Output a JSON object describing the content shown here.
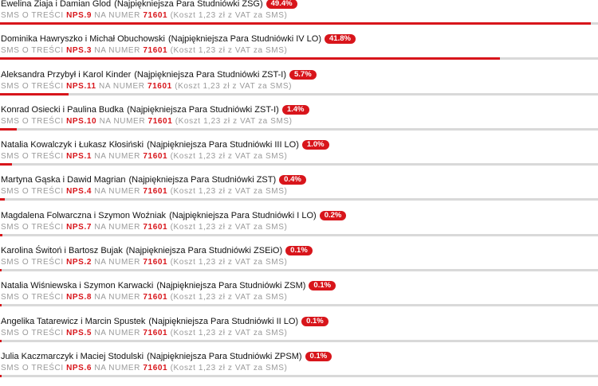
{
  "sms": {
    "prefix": "SMS O TREŚCI",
    "na_numer": "NA NUMER",
    "number": "71601",
    "cost": "(Koszt 1,23 zł z VAT za SMS)"
  },
  "contestants": [
    {
      "names": "Ewelina Ziaja i Damian Glod",
      "school": "(Najpiękniejsza Para Studniówki ZSG)",
      "percent_label": "49.4%",
      "percent": 49.4,
      "code": "NPS.9"
    },
    {
      "names": "Dominika Hawryszko i Michał Obuchowski",
      "school": "(Najpiękniejsza Para Studniówki IV LO)",
      "percent_label": "41.8%",
      "percent": 41.8,
      "code": "NPS.3"
    },
    {
      "names": "Aleksandra Przybył i Karol Kinder",
      "school": "(Najpiękniejsza Para Studniówki ZST-I)",
      "percent_label": "5.7%",
      "percent": 5.7,
      "code": "NPS.11"
    },
    {
      "names": "Konrad Osiecki i Paulina Budka",
      "school": "(Najpiękniejsza Para Studniówki ZST-I)",
      "percent_label": "1.4%",
      "percent": 1.4,
      "code": "NPS.10"
    },
    {
      "names": "Natalia Kowalczyk i Łukasz Kłosiński",
      "school": "(Najpiękniejsza Para Studniówki III LO)",
      "percent_label": "1.0%",
      "percent": 1.0,
      "code": "NPS.1"
    },
    {
      "names": "Martyna Gąska i Dawid Magrian",
      "school": "(Najpiękniejsza Para Studniówki ZST)",
      "percent_label": "0.4%",
      "percent": 0.4,
      "code": "NPS.4"
    },
    {
      "names": "Magdalena Folwarczna i Szymon Woźniak",
      "school": "(Najpiękniejsza Para Studniówki I LO)",
      "percent_label": "0.2%",
      "percent": 0.2,
      "code": "NPS.7"
    },
    {
      "names": "Karolina Świtoń i Bartosz Bujak",
      "school": "(Najpiękniejsza Para Studniówki ZSEiO)",
      "percent_label": "0.1%",
      "percent": 0.1,
      "code": "NPS.2"
    },
    {
      "names": "Natalia Wiśniewska i Szymon Karwacki",
      "school": "(Najpiękniejsza Para Studniówki ZSM)",
      "percent_label": "0.1%",
      "percent": 0.1,
      "code": "NPS.8"
    },
    {
      "names": "Angelika Tatarewicz i Marcin Spustek",
      "school": "(Najpiękniejsza Para Studniówki II LO)",
      "percent_label": "0.1%",
      "percent": 0.1,
      "code": "NPS.5"
    },
    {
      "names": "Julia Kaczmarczyk i Maciej Stodulski",
      "school": "(Najpiękniejsza Para Studniówki ZPSM)",
      "percent_label": "0.1%",
      "percent": 0.1,
      "code": "NPS.6"
    }
  ],
  "colors": {
    "accent": "#d8151b",
    "track": "#d9d9d9",
    "muted": "#9a9a9a"
  }
}
